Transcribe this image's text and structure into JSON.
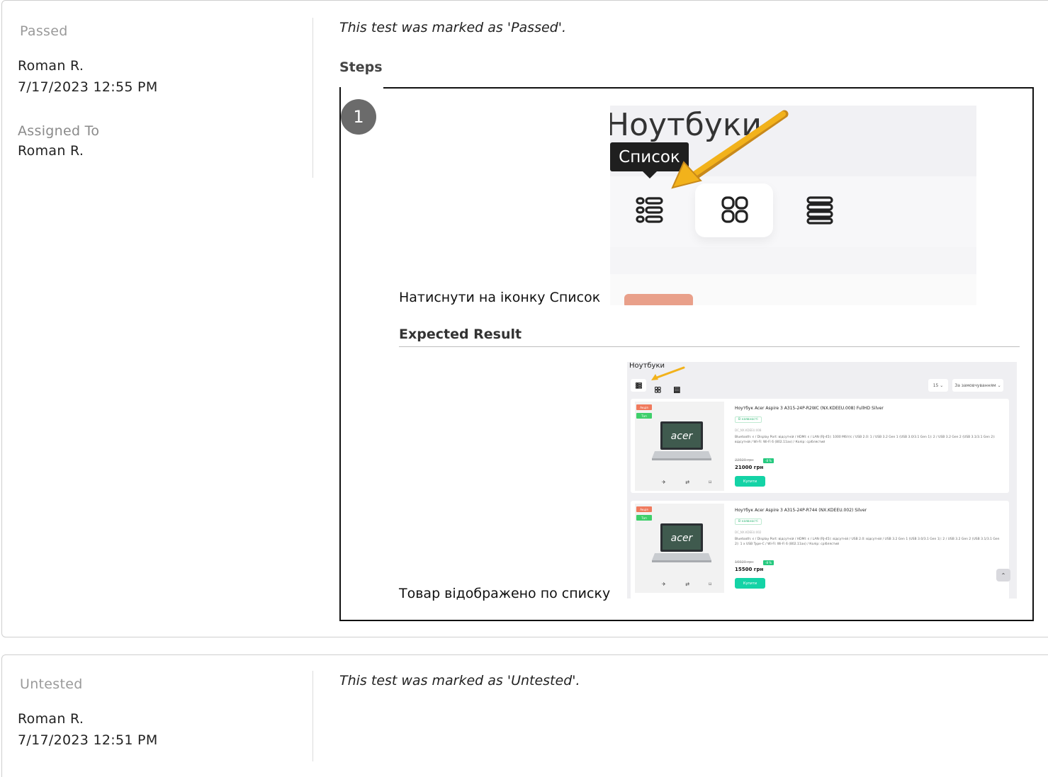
{
  "entries": [
    {
      "status": "Passed",
      "author": "Roman R.",
      "timestamp": "7/17/2023 12:55 PM",
      "assigned_label": "Assigned To",
      "assigned_to": "Roman R.",
      "note": "This test was marked as 'Passed'.",
      "steps_heading": "Steps",
      "step": {
        "number": "1",
        "text": "Натиснути на іконку Список",
        "expected_heading": "Expected Result",
        "expected_text": "Товар відображено по списку"
      },
      "screenshot1": {
        "heading": "Ноутбуки",
        "tooltip": "Список"
      },
      "screenshot2": {
        "heading": "Ноутбуки",
        "per_page": "15",
        "sort": "За замовчуванням",
        "products": [
          {
            "name": "Ноутбук Acer Aspire 3 A315-24P-R2WC (NX.KDEEU.008) FullHD Silver",
            "badge1": "Акція",
            "badge2": "Топ",
            "availability": "В наявності",
            "code": "DC_NX.KDEEU.008",
            "specs": "Bluetooth: є / Display Port: відсутній / HDMI: є / LAN (RJ-45): 1000 Мбіт/с / USB 2.0: 1 / USB 3.2 Gen 1 (USB 3.0/3.1 Gen 1): 2 / USB 3.2 Gen 2 (USB 3.1/3.1 Gen 2): відсутній / Wi-Fi: Wi-Fi 6 (802.11ax) / Колір: сріблястий",
            "old_price": "22920 грн",
            "discount": "-8 %",
            "price": "21000 грн",
            "buy": "Купити"
          },
          {
            "name": "Ноутбук Acer Aspire 3 A315-24P-R744 (NX.KDEEU.002) Silver",
            "badge1": "Акція",
            "badge2": "Топ",
            "availability": "В наявності",
            "code": "DC_NX.KDEEU.002",
            "specs": "Bluetooth: є / Display Port: відсутній / HDMI: є / LAN (RJ-45): відсутній / USB 2.0: відсутній / USB 3.2 Gen 1 (USB 3.0/3.1 Gen 1): 2 / USB 3.2 Gen 2 (USB 3.1/3.1 Gen 2): 1 x USB Type-C / Wi-Fi: Wi-Fi 6 (802.11ax) / Колір: сріблястий",
            "old_price": "16920 грн",
            "discount": "-8 %",
            "price": "15500 грн",
            "buy": "Купити"
          }
        ]
      }
    },
    {
      "status": "Untested",
      "author": "Roman R.",
      "timestamp": "7/17/2023 12:51 PM",
      "note": "This test was marked as 'Untested'."
    }
  ],
  "colors": {
    "arrow": "#f2b21b",
    "step_badge": "#6b6b6b",
    "buy_button": "#14d3a6",
    "badge_sale": "#f07a5d",
    "badge_top": "#3ecf6a"
  }
}
